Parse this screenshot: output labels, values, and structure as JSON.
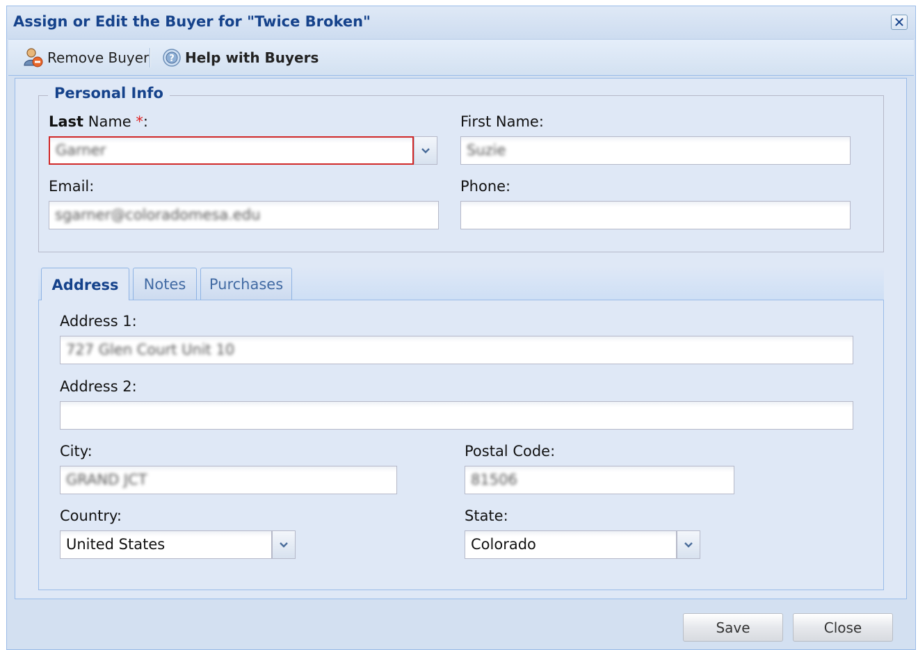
{
  "window": {
    "title": "Assign or Edit the Buyer for \"Twice Broken\"",
    "close_glyph": "✕"
  },
  "toolbar": {
    "remove_buyer_label": "Remove Buyer",
    "help_label": "Help with Buyers",
    "remove_icon": "person-remove-icon",
    "help_icon": "help-icon"
  },
  "personal_info": {
    "legend": "Personal Info",
    "last_name_label_bold": "Last",
    "last_name_label_rest": " Name ",
    "required_mark": "*",
    "last_name_colon": ":",
    "last_name_value": "Garner",
    "first_name_label": "First Name:",
    "first_name_value": "Suzie",
    "email_label": "Email:",
    "email_value": "sgarner@coloradomesa.edu",
    "phone_label": "Phone:",
    "phone_value": ""
  },
  "tabs": [
    {
      "label": "Address",
      "active": true
    },
    {
      "label": "Notes",
      "active": false
    },
    {
      "label": "Purchases",
      "active": false
    }
  ],
  "address": {
    "address1_label": "Address 1:",
    "address1_value": "727 Glen Court Unit 10",
    "address2_label": "Address 2:",
    "address2_value": "",
    "city_label": "City:",
    "city_value": "GRAND JCT",
    "postal_label": "Postal Code:",
    "postal_value": "81506",
    "country_label": "Country:",
    "country_value": "United States",
    "state_label": "State:",
    "state_value": "Colorado"
  },
  "footer": {
    "save_label": "Save",
    "close_label": "Close"
  },
  "colors": {
    "title_blue": "#15428b",
    "required_red": "#e02020",
    "invalid_border": "#d02828",
    "panel_bg": "#dfe8f6"
  }
}
